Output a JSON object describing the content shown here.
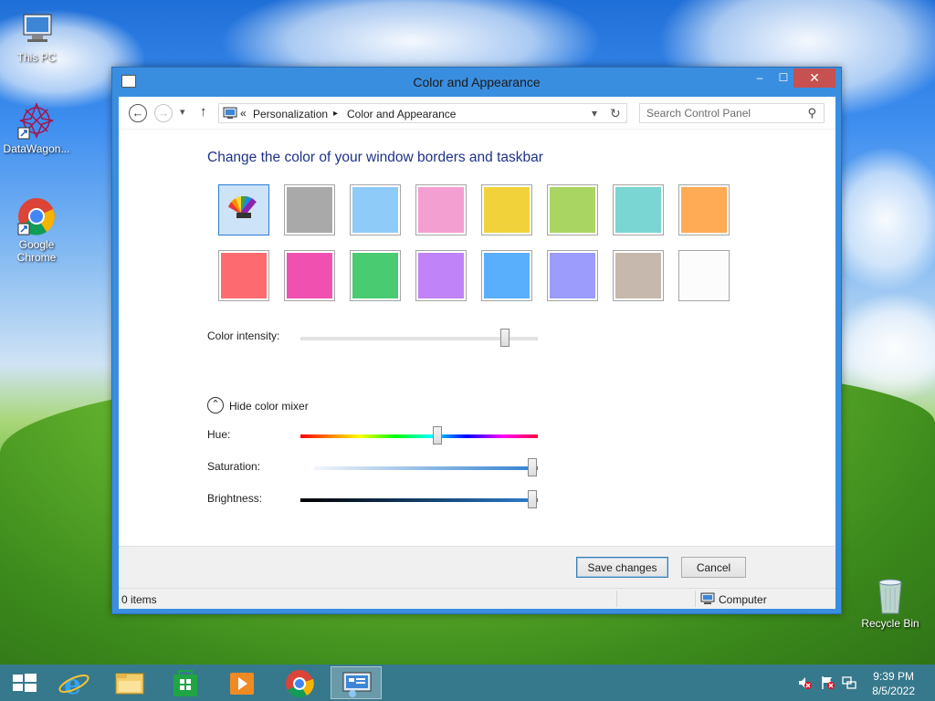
{
  "desktop": {
    "icons": [
      {
        "label": "This PC"
      },
      {
        "label": "DataWagon..."
      },
      {
        "label": "Google Chrome"
      },
      {
        "label": "Recycle Bin"
      }
    ]
  },
  "window": {
    "title": "Color and Appearance",
    "controls": {
      "minimize": "–",
      "maximize": "☐",
      "close": "✕"
    }
  },
  "navbar": {
    "back_glyph": "←",
    "forward_glyph": "→",
    "recent_glyph": "▾",
    "up_glyph": "↑",
    "breadcrumb_sep": "«",
    "crumbs": [
      "Personalization",
      "Color and Appearance"
    ],
    "crumb_arrow": "▸",
    "dropdown_glyph": "▾",
    "refresh_glyph": "↻",
    "search_placeholder": "Search Control Panel",
    "search_glyph": "⚲"
  },
  "content": {
    "heading": "Change the color of your window borders and taskbar",
    "swatches_row1": [
      "automatic",
      "#a9a9a9",
      "#8ecbf8",
      "#f49fd2",
      "#f2d23a",
      "#a9d563",
      "#79d6d2",
      "#ffaa55"
    ],
    "swatches_row2": [
      "#fd6a6f",
      "#f051b1",
      "#49cb72",
      "#c183f8",
      "#5aaffc",
      "#9b9cfb",
      "#c6b8ac",
      "#fcfcfc"
    ],
    "selected_swatch": 0,
    "intensity_label": "Color intensity:",
    "intensity_value": 0.86,
    "mixer_toggle_glyph": "⌃",
    "mixer_toggle_label": "Hide color mixer",
    "hue_label": "Hue:",
    "hue_value": 0.57,
    "saturation_label": "Saturation:",
    "saturation_value": 1.0,
    "brightness_label": "Brightness:",
    "brightness_value": 1.0
  },
  "footer": {
    "save_label": "Save changes",
    "cancel_label": "Cancel"
  },
  "statusbar": {
    "items": "0 items",
    "location": "Computer"
  },
  "taskbar": {
    "apps": [
      "start",
      "internet-explorer",
      "file-explorer",
      "store",
      "media-player",
      "chrome",
      "control-panel"
    ],
    "active_app": "control-panel",
    "time": "9:39 PM",
    "date": "8/5/2022"
  }
}
